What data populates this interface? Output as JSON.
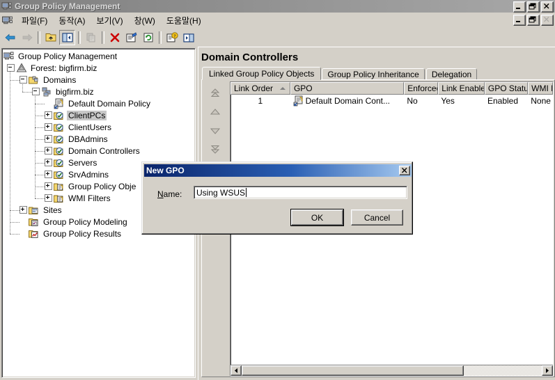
{
  "window": {
    "title": "Group Policy Management",
    "icon": "console-icon",
    "buttons": [
      {
        "name": "minimize",
        "glyph": "_"
      },
      {
        "name": "restore",
        "glyph": "❐"
      },
      {
        "name": "close",
        "glyph": "×"
      }
    ]
  },
  "menubar": {
    "icon": "mmc-child-icon",
    "items": [
      {
        "label": "파일(F)"
      },
      {
        "label": "동작(A)"
      },
      {
        "label": "보기(V)"
      },
      {
        "label": "창(W)"
      },
      {
        "label": "도움말(H)"
      }
    ],
    "child_buttons": [
      {
        "name": "child-minimize",
        "glyph": "_"
      },
      {
        "name": "child-restore",
        "glyph": "❐"
      },
      {
        "name": "child-close",
        "glyph": "×"
      }
    ]
  },
  "toolbar": {
    "buttons": [
      {
        "name": "back-icon",
        "tooltip": "뒤로",
        "state": "enabled"
      },
      {
        "name": "forward-icon",
        "tooltip": "앞으로",
        "state": "disabled"
      },
      {
        "name": "up-one-level-icon",
        "tooltip": "상위 폴더",
        "state": "enabled"
      },
      {
        "name": "show-hide-tree-icon",
        "tooltip": "콘솔 트리 표시/숨기기",
        "state": "pressed"
      },
      {
        "name": "copy-icon",
        "tooltip": "복사",
        "state": "disabled"
      },
      {
        "name": "delete-icon",
        "tooltip": "삭제",
        "state": "enabled"
      },
      {
        "name": "properties-icon",
        "tooltip": "속성",
        "state": "enabled"
      },
      {
        "name": "refresh-icon",
        "tooltip": "새로 고침",
        "state": "enabled"
      },
      {
        "name": "help-icon",
        "tooltip": "도움말",
        "state": "enabled"
      },
      {
        "name": "show-hide-pane-icon",
        "tooltip": "창 표시",
        "state": "enabled"
      }
    ]
  },
  "tree": {
    "nodes": [
      {
        "label": "Group Policy Management",
        "icon": "console-root-icon",
        "depth": 0,
        "expander": "none",
        "selected": false
      },
      {
        "label": "Forest: bigfirm.biz",
        "icon": "forest-icon",
        "depth": 1,
        "expander": "minus",
        "selected": false
      },
      {
        "label": "Domains",
        "icon": "domains-folder-icon",
        "depth": 2,
        "expander": "minus",
        "selected": false
      },
      {
        "label": "bigfirm.biz",
        "icon": "domain-icon",
        "depth": 3,
        "expander": "minus",
        "selected": false
      },
      {
        "label": "Default Domain Policy",
        "icon": "gpo-link-icon",
        "depth": 4,
        "expander": "none",
        "selected": false
      },
      {
        "label": "ClientPCs",
        "icon": "ou-icon",
        "depth": 4,
        "expander": "plus",
        "selected": true
      },
      {
        "label": "ClientUsers",
        "icon": "ou-icon",
        "depth": 4,
        "expander": "plus",
        "selected": false
      },
      {
        "label": "DBAdmins",
        "icon": "ou-icon",
        "depth": 4,
        "expander": "plus",
        "selected": false
      },
      {
        "label": "Domain Controllers",
        "icon": "ou-icon",
        "depth": 4,
        "expander": "plus",
        "selected": false
      },
      {
        "label": "Servers",
        "icon": "ou-icon",
        "depth": 4,
        "expander": "plus",
        "selected": false
      },
      {
        "label": "SrvAdmins",
        "icon": "ou-icon",
        "depth": 4,
        "expander": "plus",
        "selected": false
      },
      {
        "label": "Group Policy Obje",
        "icon": "gpo-folder-icon",
        "depth": 4,
        "expander": "plus",
        "selected": false
      },
      {
        "label": "WMI Filters",
        "icon": "wmi-folder-icon",
        "depth": 4,
        "expander": "plus",
        "selected": false
      },
      {
        "label": "Sites",
        "icon": "sites-folder-icon",
        "depth": 2,
        "expander": "plus",
        "selected": false
      },
      {
        "label": "Group Policy Modeling",
        "icon": "modeling-icon",
        "depth": 2,
        "expander": "none",
        "selected": false
      },
      {
        "label": "Group Policy Results",
        "icon": "results-icon",
        "depth": 2,
        "expander": "none",
        "selected": false
      }
    ]
  },
  "result_pane": {
    "title": "Domain Controllers",
    "tabs": [
      {
        "label": "Linked Group Policy Objects",
        "active": true
      },
      {
        "label": "Group Policy Inheritance",
        "active": false
      },
      {
        "label": "Delegation",
        "active": false
      }
    ],
    "order_buttons": [
      {
        "name": "move-link-to-top-button",
        "glyph": "move-top-icon"
      },
      {
        "name": "move-link-up-button",
        "glyph": "move-up-icon"
      },
      {
        "name": "move-link-down-button",
        "glyph": "move-down-icon"
      },
      {
        "name": "move-link-to-bottom-button",
        "glyph": "move-bottom-icon"
      }
    ],
    "table": {
      "columns": [
        {
          "label": "Link Order",
          "width": 97,
          "sorted": "asc"
        },
        {
          "label": "GPO",
          "width": 185,
          "sorted": "none"
        },
        {
          "label": "Enforced",
          "width": 55,
          "sorted": "none"
        },
        {
          "label": "Link Enabled",
          "width": 75,
          "sorted": "none"
        },
        {
          "label": "GPO Status",
          "width": 70,
          "sorted": "none"
        },
        {
          "label": "WMI F",
          "width": 40,
          "sorted": "none"
        }
      ],
      "rows": [
        {
          "link_order": "1",
          "gpo": "Default Domain Cont...",
          "gpo_icon": "gpo-link-icon",
          "enforced": "No",
          "link_enabled": "Yes",
          "gpo_status": "Enabled",
          "wmi_filter": "None"
        }
      ]
    },
    "hscroll": {
      "left_arrow": "scroll-left-icon",
      "right_arrow": "scroll-right-icon",
      "thumb_percent": 74
    }
  },
  "dialog": {
    "title": "New GPO",
    "close_glyph": "×",
    "name_label": "Name:",
    "name_value": "Using WSUS",
    "name_placeholder": "",
    "ok_label": "OK",
    "cancel_label": "Cancel"
  },
  "colors": {
    "face": "#d4d0c8",
    "dialog_title_start": "#0a246a",
    "dialog_title_end": "#a6caf0",
    "inactive_title_start": "#808080",
    "inactive_title_end": "#a8a8a8",
    "selection": "#c8c8c8",
    "folder_yellow": "#f5d76e",
    "delete_red": "#cc0000"
  }
}
